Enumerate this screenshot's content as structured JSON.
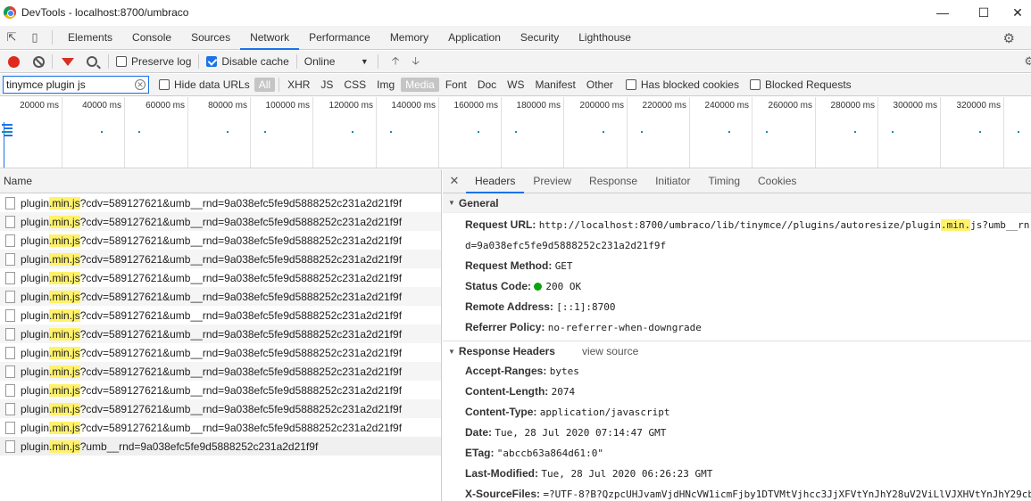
{
  "window": {
    "title": "DevTools - localhost:8700/umbraco"
  },
  "main_tabs": [
    "Elements",
    "Console",
    "Sources",
    "Network",
    "Performance",
    "Memory",
    "Application",
    "Security",
    "Lighthouse"
  ],
  "active_main_tab": "Network",
  "toolbar": {
    "preserve_log_label": "Preserve log",
    "preserve_log_checked": false,
    "disable_cache_label": "Disable cache",
    "disable_cache_checked": true,
    "throttle_value": "Online"
  },
  "filter": {
    "value": "tinymce plugin js",
    "hide_data_urls_label": "Hide data URLs",
    "types": [
      "All",
      "XHR",
      "JS",
      "CSS",
      "Img",
      "Media",
      "Font",
      "Doc",
      "WS",
      "Manifest",
      "Other"
    ],
    "has_blocked_cookies_label": "Has blocked cookies",
    "blocked_requests_label": "Blocked Requests"
  },
  "timeline": {
    "ticks": [
      "20000 ms",
      "40000 ms",
      "60000 ms",
      "80000 ms",
      "100000 ms",
      "120000 ms",
      "140000 ms",
      "160000 ms",
      "180000 ms",
      "200000 ms",
      "220000 ms",
      "240000 ms",
      "260000 ms",
      "280000 ms",
      "300000 ms",
      "320000 ms",
      "34"
    ]
  },
  "request_list": {
    "header": "Name",
    "rows": [
      {
        "pre": "plugin",
        "hl": ".min.js",
        "post": "?cdv=589127621&umb__rnd=9a038efc5fe9d5888252c231a2d21f9f"
      },
      {
        "pre": "plugin",
        "hl": ".min.js",
        "post": "?cdv=589127621&umb__rnd=9a038efc5fe9d5888252c231a2d21f9f"
      },
      {
        "pre": "plugin",
        "hl": ".min.js",
        "post": "?cdv=589127621&umb__rnd=9a038efc5fe9d5888252c231a2d21f9f"
      },
      {
        "pre": "plugin",
        "hl": ".min.js",
        "post": "?cdv=589127621&umb__rnd=9a038efc5fe9d5888252c231a2d21f9f"
      },
      {
        "pre": "plugin",
        "hl": ".min.js",
        "post": "?cdv=589127621&umb__rnd=9a038efc5fe9d5888252c231a2d21f9f"
      },
      {
        "pre": "plugin",
        "hl": ".min.js",
        "post": "?cdv=589127621&umb__rnd=9a038efc5fe9d5888252c231a2d21f9f"
      },
      {
        "pre": "plugin",
        "hl": ".min.js",
        "post": "?cdv=589127621&umb__rnd=9a038efc5fe9d5888252c231a2d21f9f"
      },
      {
        "pre": "plugin",
        "hl": ".min.js",
        "post": "?cdv=589127621&umb__rnd=9a038efc5fe9d5888252c231a2d21f9f"
      },
      {
        "pre": "plugin",
        "hl": ".min.js",
        "post": "?cdv=589127621&umb__rnd=9a038efc5fe9d5888252c231a2d21f9f"
      },
      {
        "pre": "plugin",
        "hl": ".min.js",
        "post": "?cdv=589127621&umb__rnd=9a038efc5fe9d5888252c231a2d21f9f"
      },
      {
        "pre": "plugin",
        "hl": ".min.js",
        "post": "?cdv=589127621&umb__rnd=9a038efc5fe9d5888252c231a2d21f9f"
      },
      {
        "pre": "plugin",
        "hl": ".min.js",
        "post": "?cdv=589127621&umb__rnd=9a038efc5fe9d5888252c231a2d21f9f"
      },
      {
        "pre": "plugin",
        "hl": ".min.js",
        "post": "?cdv=589127621&umb__rnd=9a038efc5fe9d5888252c231a2d21f9f"
      },
      {
        "pre": "plugin",
        "hl": ".min.js",
        "post": "?umb__rnd=9a038efc5fe9d5888252c231a2d21f9f"
      }
    ]
  },
  "details": {
    "tabs": [
      "Headers",
      "Preview",
      "Response",
      "Initiator",
      "Timing",
      "Cookies"
    ],
    "active_tab": "Headers",
    "general_title": "General",
    "general": {
      "request_url_key": "Request URL:",
      "request_url_pre": "http://localhost:8700/umbraco/lib/tinymce//plugins/autoresize/plugin",
      "request_url_hl": ".min.",
      "request_url_post": "js?umb__rn",
      "request_url_line2": "d=9a038efc5fe9d5888252c231a2d21f9f",
      "method_key": "Request Method:",
      "method_val": "GET",
      "status_key": "Status Code:",
      "status_val": "200 OK",
      "remote_key": "Remote Address:",
      "remote_val": "[::1]:8700",
      "referrer_key": "Referrer Policy:",
      "referrer_val": "no-referrer-when-downgrade"
    },
    "response_headers_title": "Response Headers",
    "view_source_label": "view source",
    "response_headers": [
      {
        "k": "Accept-Ranges:",
        "v": "bytes"
      },
      {
        "k": "Content-Length:",
        "v": "2074"
      },
      {
        "k": "Content-Type:",
        "v": "application/javascript"
      },
      {
        "k": "Date:",
        "v": "Tue, 28 Jul 2020 07:14:47 GMT"
      },
      {
        "k": "ETag:",
        "v": "\"abccb63a864d61:0\""
      },
      {
        "k": "Last-Modified:",
        "v": "Tue, 28 Jul 2020 06:26:23 GMT"
      },
      {
        "k": "X-SourceFiles:",
        "v": "=?UTF-8?B?QzpcUHJvamVjdHNcVW1icmFjby1DTVMtVjhcc3JjXFVtYnJhY28uV2ViLlVJXHVtYnJhY29cb"
      }
    ]
  },
  "colors": {
    "accent": "#1a73e8",
    "highlight": "#fff26b",
    "record": "#e0281c",
    "status_ok": "#0ca40c"
  }
}
